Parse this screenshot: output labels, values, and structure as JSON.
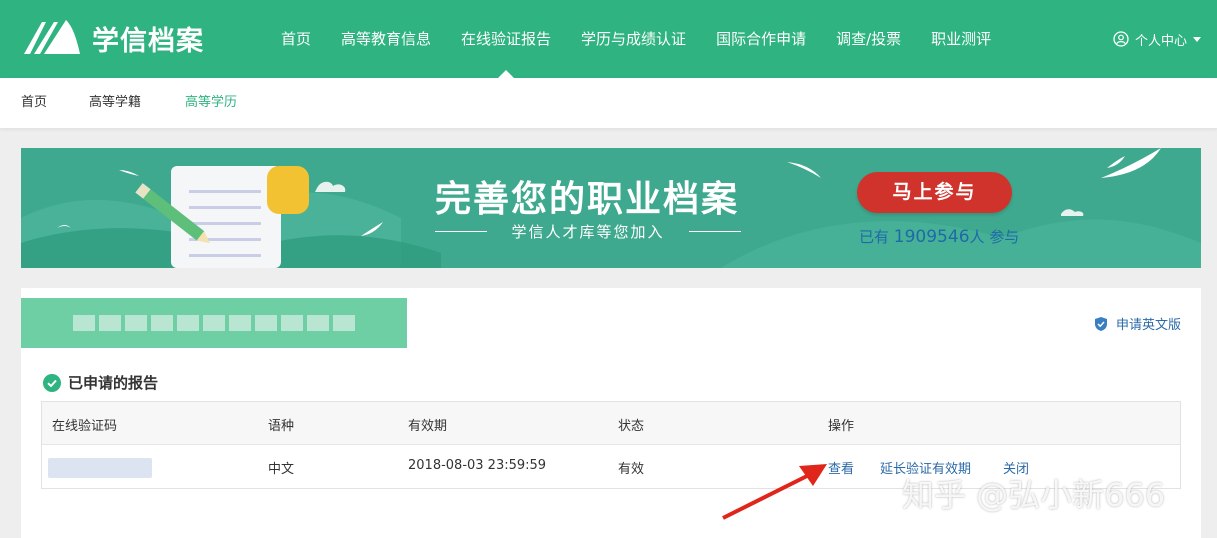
{
  "brand": {
    "name": "学信档案"
  },
  "nav": {
    "items": [
      "首页",
      "高等教育信息",
      "在线验证报告",
      "学历与成绩认证",
      "国际合作申请",
      "调查/投票",
      "职业测评"
    ],
    "active_index": 2
  },
  "user": {
    "label": "个人中心"
  },
  "subnav": {
    "items": [
      "首页",
      "高等学籍",
      "高等学历"
    ],
    "active_index": 2
  },
  "banner": {
    "title": "完善您的职业档案",
    "subtitle": "学信人才库等您加入",
    "button": "马上参与",
    "joined_prefix": "已有",
    "joined_count": "1909546",
    "joined_suffix": "人 参与"
  },
  "panel": {
    "apply_english": "申请英文版",
    "section_title": "已申请的报告",
    "table": {
      "headers": [
        "在线验证码",
        "语种",
        "有效期",
        "状态",
        "操作"
      ],
      "rows": [
        {
          "language": "中文",
          "expiry": "2018-08-03 23:59:59",
          "status": "有效",
          "actions": [
            "查看",
            "延长验证有效期",
            "关闭"
          ]
        }
      ]
    }
  },
  "watermark": "知乎 @弘小新666",
  "colors": {
    "brand_green": "#2fb381",
    "banner_teal": "#3aa88c",
    "button_red": "#d0332b",
    "link_blue": "#2b6aa8",
    "arrow_red": "#e0251b"
  }
}
